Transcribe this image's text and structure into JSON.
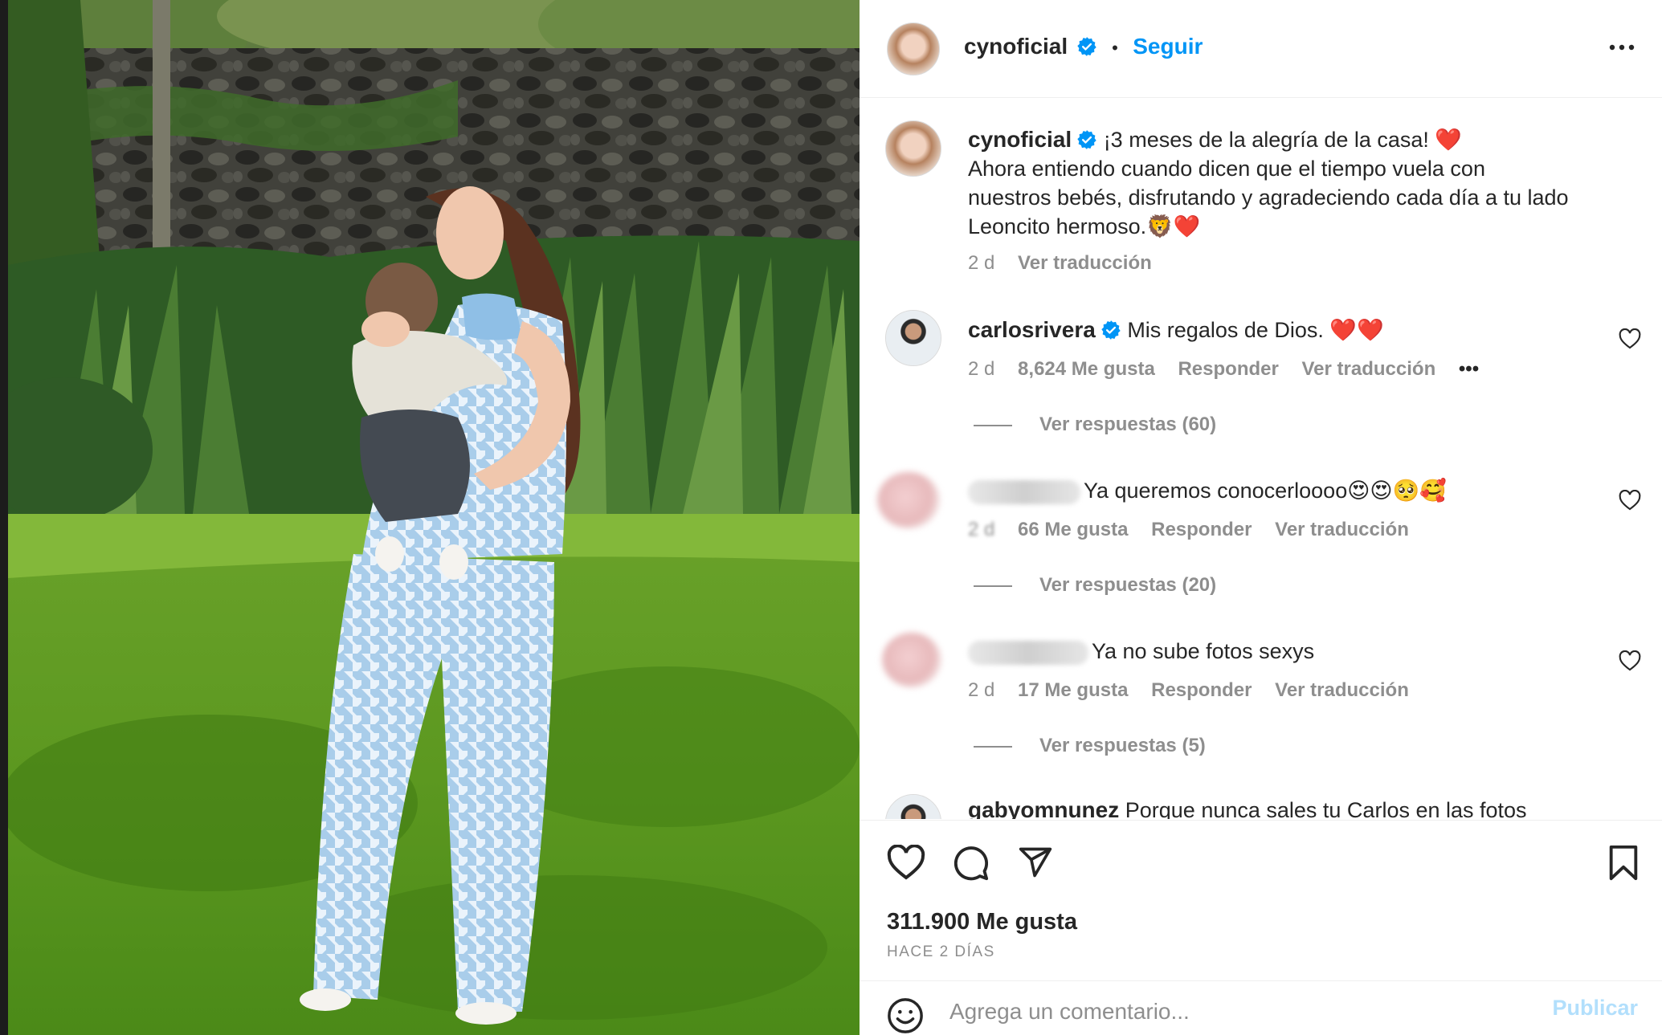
{
  "colors": {
    "accent": "#0095f6",
    "text": "#262626",
    "muted": "#8e8e8e",
    "heart": "#ed4956",
    "publish_disabled": "#b2dffc"
  },
  "header": {
    "username": "cynoficial",
    "follow_label": "Seguir",
    "verified_icon": "verified-badge-icon",
    "more_icon": "more-options-icon"
  },
  "caption": {
    "username": "cynoficial",
    "line1": "¡3 meses de la alegría de la casa! ❤️",
    "line2": "Ahora entiendo cuando dicen que el tiempo vuela con",
    "line3": "nuestros bebés, disfrutando y agradeciendo cada día a tu lado",
    "line4": "Leoncito hermoso.🦁❤️",
    "time": "2 d",
    "translate": "Ver traducción"
  },
  "comments": [
    {
      "username": "carlosrivera",
      "verified": true,
      "text": "Mis regalos de Dios. ❤️❤️",
      "time": "2 d",
      "likes": "8,624 Me gusta",
      "reply": "Responder",
      "translate": "Ver traducción",
      "more": "•••",
      "replies": "Ver respuestas (60)"
    },
    {
      "username": "",
      "text": "Ya queremos conocerloooo😍😍🥺🥰",
      "time": "2 d",
      "likes": "66 Me gusta",
      "reply": "Responder",
      "translate": "Ver traducción",
      "replies": "Ver respuestas (20)"
    },
    {
      "username": "",
      "text": "Ya no sube fotos sexys",
      "time": "2 d",
      "likes": "17 Me gusta",
      "reply": "Responder",
      "translate": "Ver traducción",
      "replies": "Ver respuestas (5)"
    },
    {
      "username": "gabyomnunez",
      "text": "Porque nunca sales tu Carlos en las fotos"
    }
  ],
  "actions": {
    "like_icon": "heart-icon",
    "comment_icon": "comment-icon",
    "share_icon": "share-icon",
    "save_icon": "bookmark-icon",
    "likes": "311.900 Me gusta",
    "time_ago": "HACE 2 DÍAS"
  },
  "add_comment": {
    "emoji_icon": "emoji-icon",
    "placeholder": "Agrega un comentario...",
    "publish": "Publicar"
  }
}
